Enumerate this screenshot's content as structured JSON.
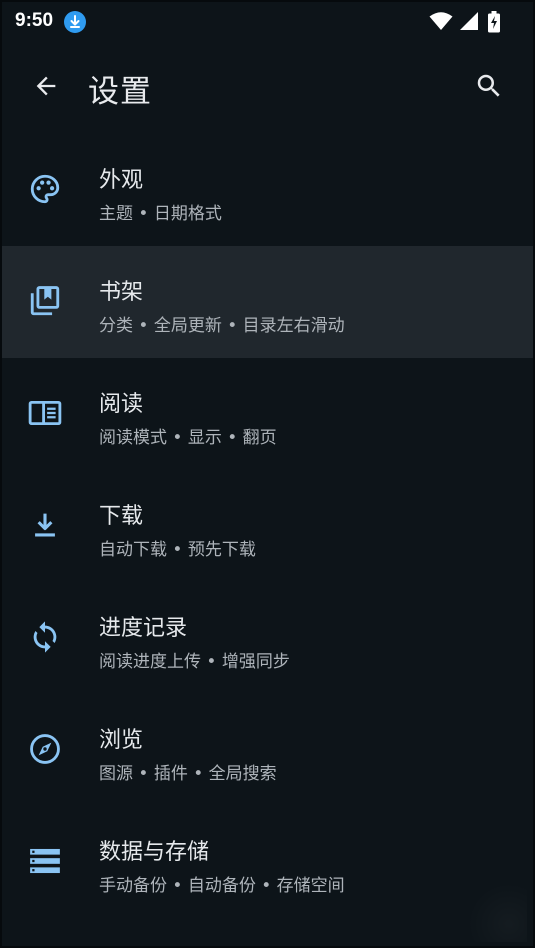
{
  "status_bar": {
    "time": "9:50",
    "icons": [
      "download-icon",
      "wifi-icon",
      "signal-icon",
      "battery-charging-icon"
    ]
  },
  "toolbar": {
    "title": "设置",
    "back_icon": "arrow-back-icon",
    "search_icon": "search-icon"
  },
  "accent": "#8ac4f3",
  "settings": [
    {
      "id": "appearance",
      "icon": "palette-icon",
      "title": "外观",
      "subtitle": "主题 • 日期格式"
    },
    {
      "id": "library",
      "icon": "library-bookmark-icon",
      "title": "书架",
      "subtitle": "分类 • 全局更新 • 目录左右滑动"
    },
    {
      "id": "reader",
      "icon": "chrome-reader-icon",
      "title": "阅读",
      "subtitle": "阅读模式 • 显示 • 翻页"
    },
    {
      "id": "downloads",
      "icon": "download-icon",
      "title": "下载",
      "subtitle": "自动下载 • 预先下载"
    },
    {
      "id": "tracking",
      "icon": "sync-icon",
      "title": "进度记录",
      "subtitle": "阅读进度上传 • 增强同步"
    },
    {
      "id": "browse",
      "icon": "compass-icon",
      "title": "浏览",
      "subtitle": "图源 • 插件 • 全局搜索"
    },
    {
      "id": "storage",
      "icon": "storage-icon",
      "title": "数据与存储",
      "subtitle": "手动备份 • 自动备份 • 存储空间"
    }
  ]
}
